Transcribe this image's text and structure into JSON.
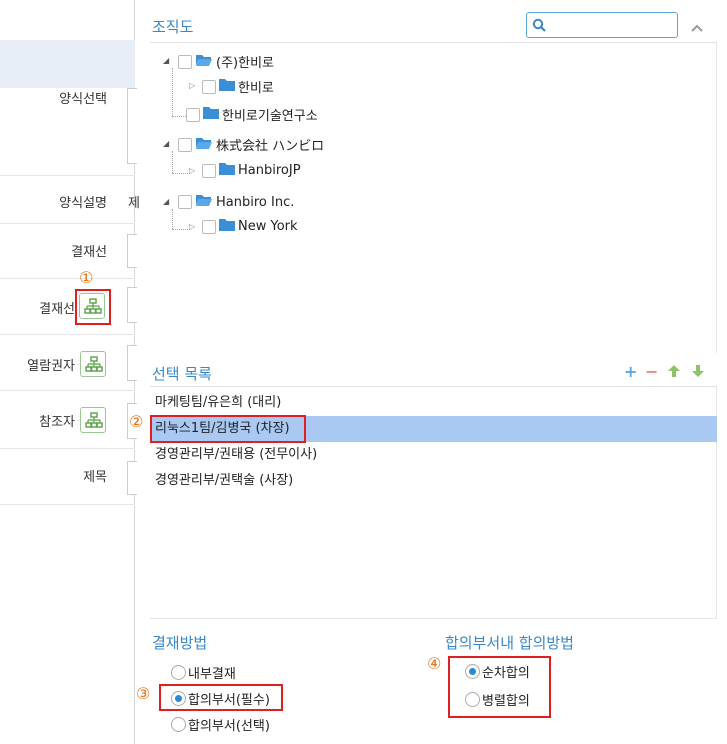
{
  "form": {
    "labels": {
      "template_select": "양식선택",
      "template_desc": "양식설명",
      "approval_line": "결재선",
      "approval_line2": "결재선",
      "viewer": "열람권자",
      "cc": "참조자",
      "subject": "제목"
    },
    "desc_peek": "제"
  },
  "org": {
    "title": "조직도",
    "search_placeholder": "",
    "tree": [
      {
        "label": "(주)한비로",
        "children": [
          "한비로",
          "한비로기술연구소"
        ]
      },
      {
        "label": "株式会社 ハンビロ",
        "children": [
          "HanbiroJP"
        ]
      },
      {
        "label": "Hanbiro Inc.",
        "children": [
          "New York"
        ]
      }
    ]
  },
  "selection": {
    "title": "선택 목록",
    "items": [
      "마케팅팀/유은희 (대리)",
      "리눅스1팀/김병국 (차장)",
      "경영관리부/권태용 (전무이사)",
      "경영관리부/권택술 (사장)"
    ],
    "selected_index": 1
  },
  "method": {
    "title": "결재방법",
    "options": [
      "내부결재",
      "합의부서(필수)",
      "합의부서(선택)"
    ],
    "selected": 1
  },
  "dept_method": {
    "title": "합의부서내 합의방법",
    "options": [
      "순차합의",
      "병렬합의"
    ],
    "selected": 0
  },
  "markers": [
    "①",
    "②",
    "③",
    "④"
  ],
  "colors": {
    "accent": "#3a88c8",
    "highlight": "#a9c9f3",
    "marker": "#e8731c",
    "red_box": "#e02020",
    "green_icons": "#6ab04c"
  }
}
